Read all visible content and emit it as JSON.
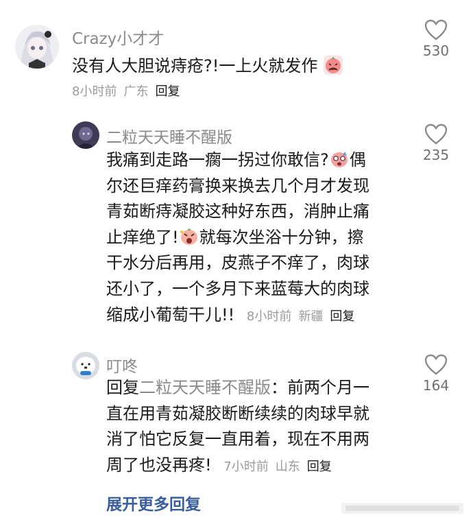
{
  "comments": [
    {
      "username": "Crazy小才才",
      "text": "没有人大胆说痔疮?!一上火就发作",
      "time": "8小时前",
      "location": "广东",
      "reply": "回复",
      "likes": "530",
      "avatar_icon": "anime-girl-avatar",
      "emoji_icon": "crying-face-emoji"
    },
    {
      "username": "二粒天天睡不醒版",
      "text_1": "我痛到走路一瘸一拐过你敢信?",
      "text_2": "偶",
      "line_2": "尔还巨痒药膏换来换去几个月才发现",
      "line_3": "青茹断痔凝胶这种好东西，消肿止痛",
      "line_4a": "止痒绝了!",
      "line_4b": "就每次坐浴十分钟，擦",
      "line_5": "干水分后再用，皮燕子不痒了，肉球",
      "line_6": "还小了，一个多月下来蓝莓大的肉球",
      "line_7": "缩成小葡萄干儿!!",
      "time": "8小时前",
      "location": "新疆",
      "reply": "回复",
      "likes": "235",
      "avatar_icon": "dark-anime-avatar"
    },
    {
      "username": "叮咚",
      "reply_prefix": "回复",
      "reply_to": "二粒天天睡不醒版",
      "line_1_rest": "：前两个月一",
      "line_2": "直在用青茹凝胶断断续续的肉球早就",
      "line_3": "消了怕它反复一直用着，现在不用两",
      "line_4": "周了也没再疼!",
      "time": "7小时前",
      "location": "山东",
      "reply": "回复",
      "likes": "164",
      "avatar_icon": "white-dog-avatar"
    }
  ],
  "expand_label": "展开更多回复",
  "colors": {
    "meta": "#9b9b9b",
    "username": "#8a8a8a",
    "link": "#3a5e9a"
  }
}
